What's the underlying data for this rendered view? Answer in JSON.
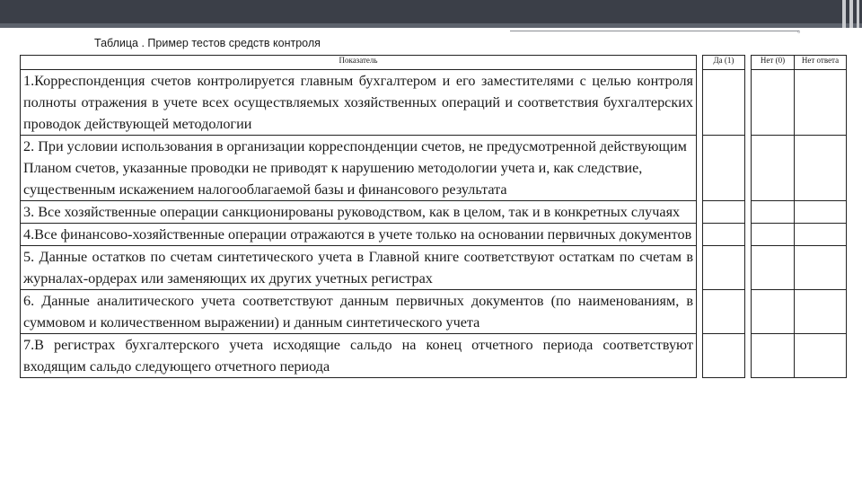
{
  "caption": "Таблица . Пример тестов средств контроля",
  "corner_mark": "▫",
  "table": {
    "header": {
      "indicator": "Показатель",
      "yes": "Да (1)",
      "no": "Нет (0)",
      "no_answer": "Нет ответа"
    },
    "rows": [
      "1.Корреспонденция счетов контролируется главным бухгалтером и его заместителями с целью контроля полноты отражения в учете всех осуществляемых хозяйственных операций и соответствия бухгалтерских проводок действующей методологии",
      "2. При условии использования в организации корреспонденции счетов, не предусмотренной действующим Планом счетов, указанные проводки не приводят к нарушению методологии учета и, как следствие, существенным искажением налогооблагаемой базы и финансового результата",
      "3. Все хозяйственные операции санкционированы руководством, как в целом, так и в конкретных случаях",
      "4.Все финансово-хозяйственные операции отражаются в учете только на основании первичных документов",
      "5. Данные остатков по счетам синтетического учета в Главной книге соответствуют остаткам по счетам в журналах-ордерах или заменяющих их других учетных регистрах",
      "6. Данные аналитического учета соответствуют данным первичных документов (по наименованиям, в суммовом и количественном выражении) и данным синтетического учета",
      "7.В регистрах бухгалтерского учета исходящие сальдо на конец отчетного периода соответствуют входящим сальдо следующего отчетного периода"
    ]
  }
}
